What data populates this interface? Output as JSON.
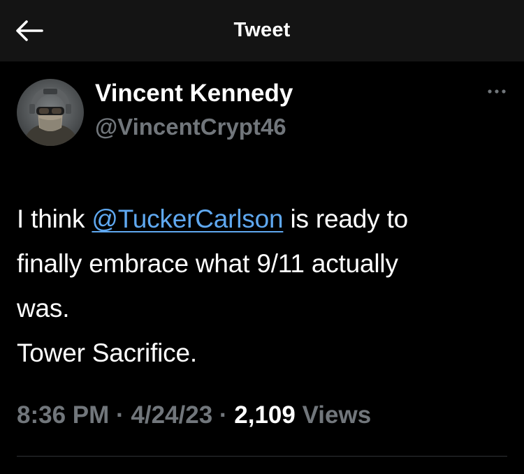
{
  "header": {
    "title": "Tweet",
    "back_icon": "arrow-left-icon",
    "background": "#141414"
  },
  "author": {
    "display_name": "Vincent Kennedy",
    "handle": "@VincentCrypt46",
    "avatar_icon": "avatar-helmet-portrait",
    "more_icon": "more-horizontal-icon"
  },
  "tweet": {
    "line1_before": "I think ",
    "mention": "@TuckerCarlson",
    "line1_after": " is ready to",
    "line2": "finally embrace what 9/11 actually",
    "line3": "was.",
    "line4": "Tower Sacrifice."
  },
  "meta": {
    "time": "8:36 PM",
    "sep1": " · ",
    "date": "4/24/23",
    "sep2": " · ",
    "views_count": "2,109",
    "views_label": " Views"
  },
  "colors": {
    "background": "#000000",
    "primary_text": "#ffffff",
    "secondary_text": "#71767b",
    "mention": "#5fa8f0",
    "divider": "#2f3336"
  }
}
